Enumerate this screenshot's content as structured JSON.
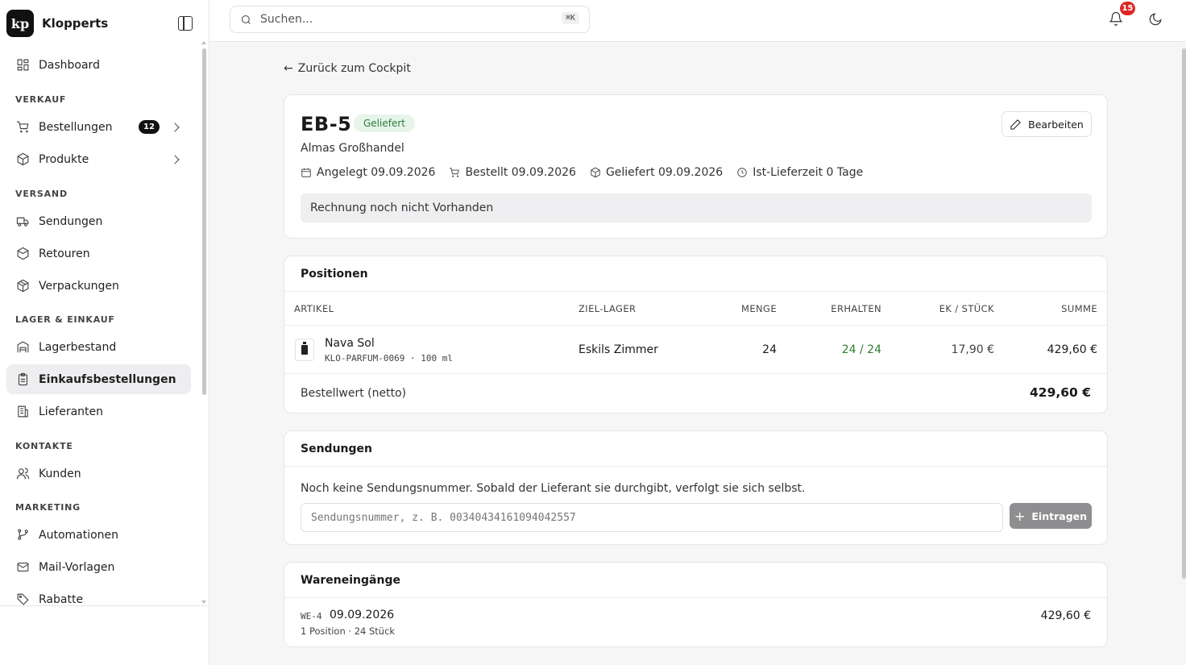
{
  "brand": {
    "logo_text": "kp",
    "name": "Klopperts"
  },
  "nav": {
    "dashboard": "Dashboard",
    "sections": [
      "VERKAUF",
      "VERSAND",
      "LAGER & EINKAUF",
      "KONTAKTE",
      "MARKETING"
    ],
    "items": [
      {
        "label": "Bestellungen",
        "badge": "12",
        "icon": "cart-icon"
      },
      {
        "label": "Produkte",
        "icon": "package-icon"
      },
      {
        "label": "Sendungen",
        "icon": "truck-icon"
      },
      {
        "label": "Retouren",
        "icon": "box-return-icon"
      },
      {
        "label": "Verpackungen",
        "icon": "box-icon"
      },
      {
        "label": "Lagerbestand",
        "icon": "warehouse-icon"
      },
      {
        "label": "Einkaufsbestellungen",
        "icon": "clipboard-icon",
        "active": true
      },
      {
        "label": "Lieferanten",
        "icon": "building-icon"
      },
      {
        "label": "Kunden",
        "icon": "users-icon"
      },
      {
        "label": "Automationen",
        "icon": "workflow-icon"
      },
      {
        "label": "Mail-Vorlagen",
        "icon": "mail-icon"
      },
      {
        "label": "Rabatte",
        "icon": "tag-icon"
      }
    ]
  },
  "topbar": {
    "search_placeholder": "Suchen...",
    "shortcut": "⌘K",
    "notifications": "15"
  },
  "back_link": "Zurück zum Cockpit",
  "order": {
    "id": "EB-5",
    "status": "Geliefert",
    "edit_label": "Bearbeiten",
    "supplier": "Almas Großhandel",
    "created": "Angelegt 09.09.2026",
    "ordered": "Bestellt 09.09.2026",
    "delivered": "Geliefert 09.09.2026",
    "lead_time": "Ist-Lieferzeit 0 Tage",
    "invoice_note": "Rechnung noch nicht Vorhanden"
  },
  "positions": {
    "title": "Positionen",
    "columns": [
      "ARTIKEL",
      "ZIEL-LAGER",
      "MENGE",
      "ERHALTEN",
      "EK / STÜCK",
      "SUMME"
    ],
    "rows": [
      {
        "name": "Nava Sol",
        "sku": "KLO-PARFUM-0069 · 100 ml",
        "warehouse": "Eskils Zimmer",
        "qty": "24",
        "received": "24 / 24",
        "unit_price": "17,90 €",
        "sum": "429,60 €"
      }
    ],
    "total_label": "Bestellwert (netto)",
    "total_value": "429,60 €"
  },
  "shipments": {
    "title": "Sendungen",
    "note": "Noch keine Sendungsnummer. Sobald der Lieferant sie durchgibt, verfolgt sie sich selbst.",
    "placeholder": "Sendungsnummer, z. B. 00340434161094042557",
    "button": "Eintragen"
  },
  "receipts": {
    "title": "Wareneingänge",
    "items": [
      {
        "id": "WE-4",
        "date": "09.09.2026",
        "summary": "1 Position · 24 Stück",
        "amount": "429,60 €"
      }
    ]
  }
}
